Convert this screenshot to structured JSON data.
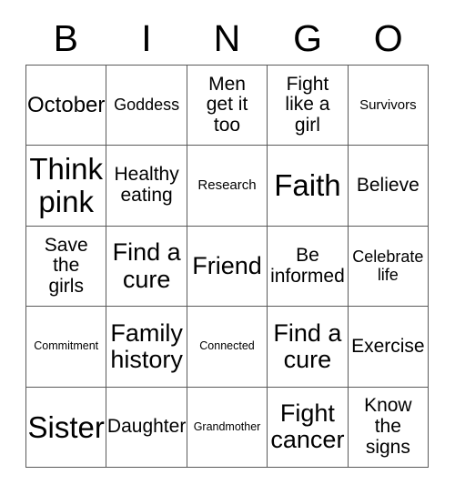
{
  "card": {
    "title": "BINGO",
    "header_letters": [
      "B",
      "I",
      "N",
      "G",
      "O"
    ],
    "colors": {
      "background": "#ffffff",
      "text": "#000000",
      "grid_line": "#5a5a5a"
    },
    "grid": {
      "columns": 5,
      "rows": 5,
      "cells": [
        [
          {
            "text": "October",
            "size": "lg"
          },
          {
            "text": "Goddess",
            "size": "sm"
          },
          {
            "text": "Men\nget it\ntoo",
            "size": "md"
          },
          {
            "text": "Fight\nlike a\ngirl",
            "size": "md"
          },
          {
            "text": "Survivors",
            "size": "xs"
          }
        ],
        [
          {
            "text": "Think\npink",
            "size": "xxl"
          },
          {
            "text": "Healthy\neating",
            "size": "md"
          },
          {
            "text": "Research",
            "size": "xs"
          },
          {
            "text": "Faith",
            "size": "xxl"
          },
          {
            "text": "Believe",
            "size": "md"
          }
        ],
        [
          {
            "text": "Save\nthe\ngirls",
            "size": "md"
          },
          {
            "text": "Find a\ncure",
            "size": "xl"
          },
          {
            "text": "Friend",
            "size": "xl"
          },
          {
            "text": "Be\ninformed",
            "size": "md"
          },
          {
            "text": "Celebrate\nlife",
            "size": "sm"
          }
        ],
        [
          {
            "text": "Commitment",
            "size": "xxs"
          },
          {
            "text": "Family\nhistory",
            "size": "xl"
          },
          {
            "text": "Connected",
            "size": "xxs"
          },
          {
            "text": "Find a\ncure",
            "size": "xl"
          },
          {
            "text": "Exercise",
            "size": "md"
          }
        ],
        [
          {
            "text": "Sister",
            "size": "xxl"
          },
          {
            "text": "Daughter",
            "size": "md"
          },
          {
            "text": "Grandmother",
            "size": "xxs"
          },
          {
            "text": "Fight\ncancer",
            "size": "xl"
          },
          {
            "text": "Know\nthe\nsigns",
            "size": "md"
          }
        ]
      ]
    }
  }
}
